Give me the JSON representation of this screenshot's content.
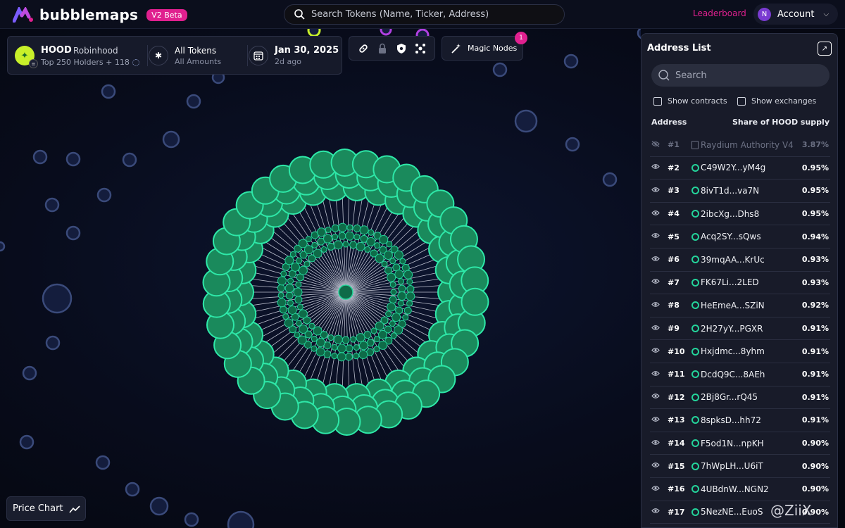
{
  "brand": {
    "name": "bubblemaps",
    "badge": "V2 Beta"
  },
  "topbar": {
    "search_placeholder": "Search Tokens (Name, Ticker, Address)",
    "leaderboard": "Leaderboard",
    "account_initial": "N",
    "account_label": "Account"
  },
  "token": {
    "symbol": "HOOD",
    "name": "Robinhood",
    "holders": "Top 250 Holders + 118",
    "filter_title": "All Tokens",
    "filter_sub": "All Amounts",
    "date": "Jan 30, 2025",
    "date_sub": "2d ago"
  },
  "toolbar": {
    "tools": [
      "link-icon",
      "lock-icon",
      "shield-icon",
      "cluster-icon"
    ],
    "magic_label": "Magic Nodes",
    "magic_badge": "1"
  },
  "address_list": {
    "title": "Address List",
    "search_placeholder": "Search",
    "show_contracts": "Show contracts",
    "show_exchanges": "Show exchanges",
    "col_address": "Address",
    "col_share": "Share of HOOD supply",
    "rows": [
      {
        "rank": "#1",
        "address": "Raydium Authority V4",
        "share": "3.87%",
        "contract": true
      },
      {
        "rank": "#2",
        "address": "C49W2Y...yM4g",
        "share": "0.95%"
      },
      {
        "rank": "#3",
        "address": "8ivT1d...va7N",
        "share": "0.95%"
      },
      {
        "rank": "#4",
        "address": "2ibcXg...Dhs8",
        "share": "0.95%"
      },
      {
        "rank": "#5",
        "address": "Acq2SY...sQws",
        "share": "0.94%"
      },
      {
        "rank": "#6",
        "address": "39mqAA...KrUc",
        "share": "0.93%"
      },
      {
        "rank": "#7",
        "address": "FK67Li...2LED",
        "share": "0.93%"
      },
      {
        "rank": "#8",
        "address": "HeEmeA...SZiN",
        "share": "0.92%"
      },
      {
        "rank": "#9",
        "address": "2H27yY...PGXR",
        "share": "0.91%"
      },
      {
        "rank": "#10",
        "address": "Hxjdmc...8yhm",
        "share": "0.91%"
      },
      {
        "rank": "#11",
        "address": "DcdQ9C...8AEh",
        "share": "0.91%"
      },
      {
        "rank": "#12",
        "address": "2Bj8Gr...rQ45",
        "share": "0.91%"
      },
      {
        "rank": "#13",
        "address": "8spksD...hh72",
        "share": "0.91%"
      },
      {
        "rank": "#14",
        "address": "F5od1N...npKH",
        "share": "0.90%"
      },
      {
        "rank": "#15",
        "address": "7hWpLH...U6iT",
        "share": "0.90%"
      },
      {
        "rank": "#16",
        "address": "4UBdnW...NGN2",
        "share": "0.90%"
      },
      {
        "rank": "#17",
        "address": "5NezNE...EuoS",
        "share": "0.90%"
      }
    ]
  },
  "price_chart_label": "Price Chart",
  "watermark": "@ZiiX",
  "colors": {
    "accent": "#e0208f",
    "node_green": "#24d39a",
    "bubble_blue": "#1c2a52"
  }
}
